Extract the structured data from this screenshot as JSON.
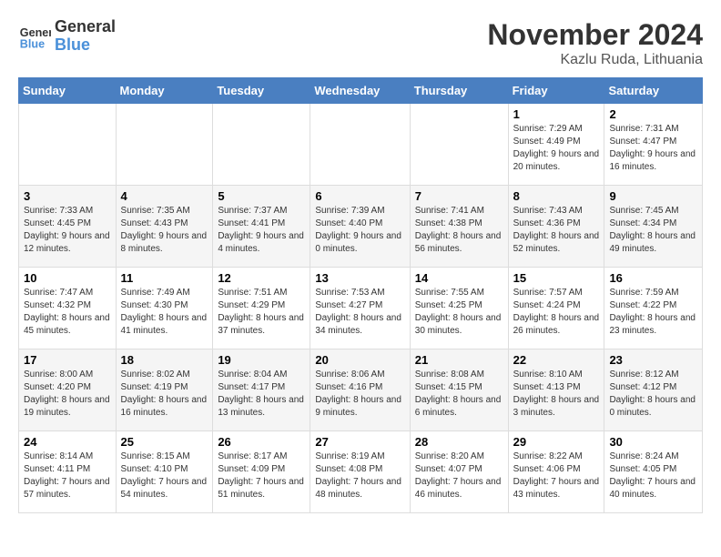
{
  "header": {
    "logo_line1": "General",
    "logo_line2": "Blue",
    "title": "November 2024",
    "subtitle": "Kazlu Ruda, Lithuania"
  },
  "weekdays": [
    "Sunday",
    "Monday",
    "Tuesday",
    "Wednesday",
    "Thursday",
    "Friday",
    "Saturday"
  ],
  "weeks": [
    [
      {
        "day": "",
        "info": ""
      },
      {
        "day": "",
        "info": ""
      },
      {
        "day": "",
        "info": ""
      },
      {
        "day": "",
        "info": ""
      },
      {
        "day": "",
        "info": ""
      },
      {
        "day": "1",
        "info": "Sunrise: 7:29 AM\nSunset: 4:49 PM\nDaylight: 9 hours and 20 minutes."
      },
      {
        "day": "2",
        "info": "Sunrise: 7:31 AM\nSunset: 4:47 PM\nDaylight: 9 hours and 16 minutes."
      }
    ],
    [
      {
        "day": "3",
        "info": "Sunrise: 7:33 AM\nSunset: 4:45 PM\nDaylight: 9 hours and 12 minutes."
      },
      {
        "day": "4",
        "info": "Sunrise: 7:35 AM\nSunset: 4:43 PM\nDaylight: 9 hours and 8 minutes."
      },
      {
        "day": "5",
        "info": "Sunrise: 7:37 AM\nSunset: 4:41 PM\nDaylight: 9 hours and 4 minutes."
      },
      {
        "day": "6",
        "info": "Sunrise: 7:39 AM\nSunset: 4:40 PM\nDaylight: 9 hours and 0 minutes."
      },
      {
        "day": "7",
        "info": "Sunrise: 7:41 AM\nSunset: 4:38 PM\nDaylight: 8 hours and 56 minutes."
      },
      {
        "day": "8",
        "info": "Sunrise: 7:43 AM\nSunset: 4:36 PM\nDaylight: 8 hours and 52 minutes."
      },
      {
        "day": "9",
        "info": "Sunrise: 7:45 AM\nSunset: 4:34 PM\nDaylight: 8 hours and 49 minutes."
      }
    ],
    [
      {
        "day": "10",
        "info": "Sunrise: 7:47 AM\nSunset: 4:32 PM\nDaylight: 8 hours and 45 minutes."
      },
      {
        "day": "11",
        "info": "Sunrise: 7:49 AM\nSunset: 4:30 PM\nDaylight: 8 hours and 41 minutes."
      },
      {
        "day": "12",
        "info": "Sunrise: 7:51 AM\nSunset: 4:29 PM\nDaylight: 8 hours and 37 minutes."
      },
      {
        "day": "13",
        "info": "Sunrise: 7:53 AM\nSunset: 4:27 PM\nDaylight: 8 hours and 34 minutes."
      },
      {
        "day": "14",
        "info": "Sunrise: 7:55 AM\nSunset: 4:25 PM\nDaylight: 8 hours and 30 minutes."
      },
      {
        "day": "15",
        "info": "Sunrise: 7:57 AM\nSunset: 4:24 PM\nDaylight: 8 hours and 26 minutes."
      },
      {
        "day": "16",
        "info": "Sunrise: 7:59 AM\nSunset: 4:22 PM\nDaylight: 8 hours and 23 minutes."
      }
    ],
    [
      {
        "day": "17",
        "info": "Sunrise: 8:00 AM\nSunset: 4:20 PM\nDaylight: 8 hours and 19 minutes."
      },
      {
        "day": "18",
        "info": "Sunrise: 8:02 AM\nSunset: 4:19 PM\nDaylight: 8 hours and 16 minutes."
      },
      {
        "day": "19",
        "info": "Sunrise: 8:04 AM\nSunset: 4:17 PM\nDaylight: 8 hours and 13 minutes."
      },
      {
        "day": "20",
        "info": "Sunrise: 8:06 AM\nSunset: 4:16 PM\nDaylight: 8 hours and 9 minutes."
      },
      {
        "day": "21",
        "info": "Sunrise: 8:08 AM\nSunset: 4:15 PM\nDaylight: 8 hours and 6 minutes."
      },
      {
        "day": "22",
        "info": "Sunrise: 8:10 AM\nSunset: 4:13 PM\nDaylight: 8 hours and 3 minutes."
      },
      {
        "day": "23",
        "info": "Sunrise: 8:12 AM\nSunset: 4:12 PM\nDaylight: 8 hours and 0 minutes."
      }
    ],
    [
      {
        "day": "24",
        "info": "Sunrise: 8:14 AM\nSunset: 4:11 PM\nDaylight: 7 hours and 57 minutes."
      },
      {
        "day": "25",
        "info": "Sunrise: 8:15 AM\nSunset: 4:10 PM\nDaylight: 7 hours and 54 minutes."
      },
      {
        "day": "26",
        "info": "Sunrise: 8:17 AM\nSunset: 4:09 PM\nDaylight: 7 hours and 51 minutes."
      },
      {
        "day": "27",
        "info": "Sunrise: 8:19 AM\nSunset: 4:08 PM\nDaylight: 7 hours and 48 minutes."
      },
      {
        "day": "28",
        "info": "Sunrise: 8:20 AM\nSunset: 4:07 PM\nDaylight: 7 hours and 46 minutes."
      },
      {
        "day": "29",
        "info": "Sunrise: 8:22 AM\nSunset: 4:06 PM\nDaylight: 7 hours and 43 minutes."
      },
      {
        "day": "30",
        "info": "Sunrise: 8:24 AM\nSunset: 4:05 PM\nDaylight: 7 hours and 40 minutes."
      }
    ]
  ]
}
